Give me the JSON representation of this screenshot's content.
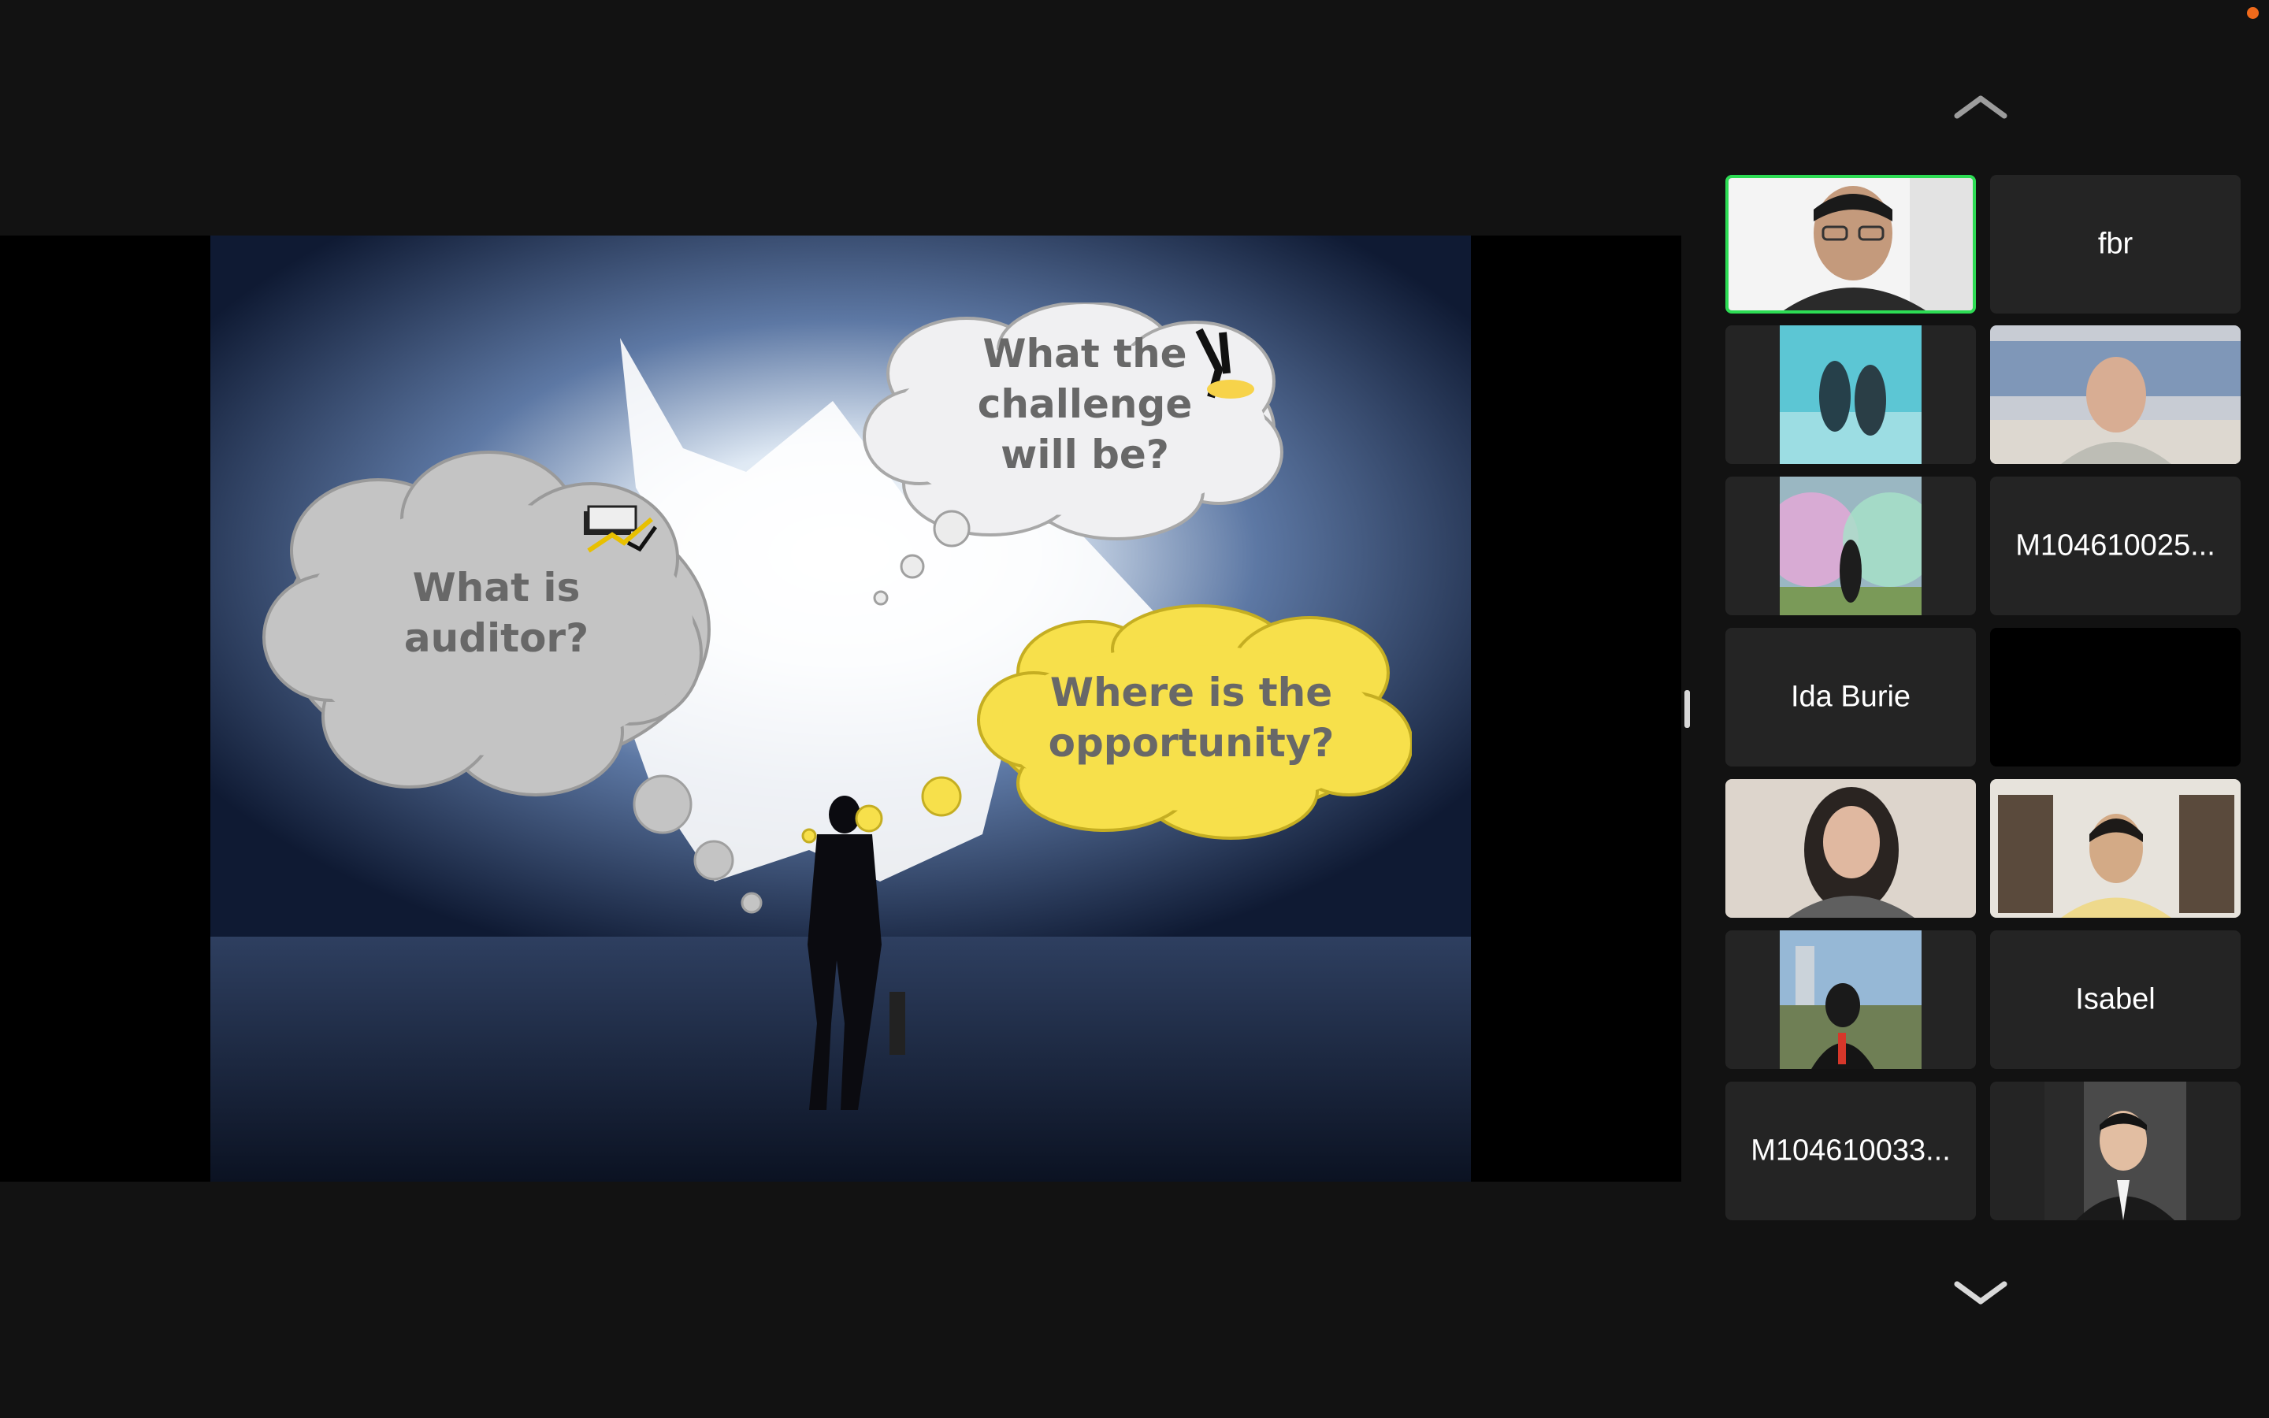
{
  "slide": {
    "cloud_left": [
      "What is",
      "auditor?"
    ],
    "cloud_top": [
      "What the",
      "challenge",
      "will be?"
    ],
    "cloud_right": [
      "Where is the",
      "opportunity?"
    ]
  },
  "gallery": {
    "tiles": [
      {
        "name": "",
        "video": true
      },
      {
        "name": "fbr",
        "video": false
      },
      {
        "name": "",
        "video": true
      },
      {
        "name": "",
        "video": true
      },
      {
        "name": "",
        "video": true
      },
      {
        "name": "M104610025...",
        "video": false
      },
      {
        "name": "Ida Burie",
        "video": false
      },
      {
        "name": "",
        "video": false
      },
      {
        "name": "",
        "video": true
      },
      {
        "name": "",
        "video": true
      },
      {
        "name": "",
        "video": true
      },
      {
        "name": "Isabel",
        "video": false
      },
      {
        "name": "M104610033...",
        "video": false
      },
      {
        "name": "",
        "video": true
      }
    ]
  },
  "colors": {
    "active_speaker_border": "#2ddc54",
    "notification_dot": "#f06a1b",
    "cloud_yellow": "#f7e04b",
    "cloud_gray": "#c4c4c4"
  }
}
